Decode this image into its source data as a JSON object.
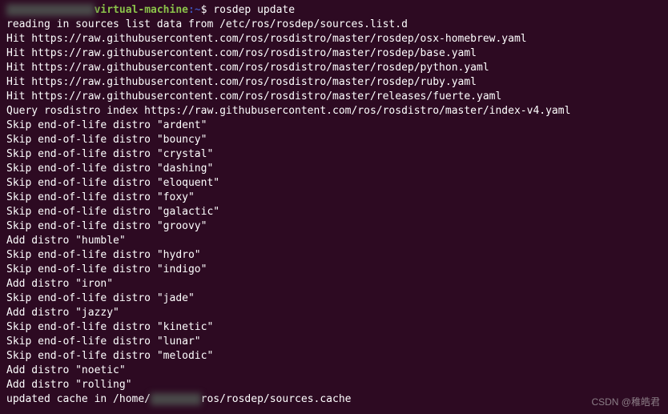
{
  "prompt": {
    "user_blur": "xxxxxxxxxxxxxx",
    "host_suffix": "virtual-machine",
    "separator": ":",
    "path": "~",
    "symbol": "$",
    "command": "rosdep update"
  },
  "output": [
    "reading in sources list data from /etc/ros/rosdep/sources.list.d",
    "Hit https://raw.githubusercontent.com/ros/rosdistro/master/rosdep/osx-homebrew.yaml",
    "Hit https://raw.githubusercontent.com/ros/rosdistro/master/rosdep/base.yaml",
    "Hit https://raw.githubusercontent.com/ros/rosdistro/master/rosdep/python.yaml",
    "Hit https://raw.githubusercontent.com/ros/rosdistro/master/rosdep/ruby.yaml",
    "Hit https://raw.githubusercontent.com/ros/rosdistro/master/releases/fuerte.yaml",
    "Query rosdistro index https://raw.githubusercontent.com/ros/rosdistro/master/index-v4.yaml",
    "Skip end-of-life distro \"ardent\"",
    "Skip end-of-life distro \"bouncy\"",
    "Skip end-of-life distro \"crystal\"",
    "Skip end-of-life distro \"dashing\"",
    "Skip end-of-life distro \"eloquent\"",
    "Skip end-of-life distro \"foxy\"",
    "Skip end-of-life distro \"galactic\"",
    "Skip end-of-life distro \"groovy\"",
    "Add distro \"humble\"",
    "Skip end-of-life distro \"hydro\"",
    "Skip end-of-life distro \"indigo\"",
    "Add distro \"iron\"",
    "Skip end-of-life distro \"jade\"",
    "Add distro \"jazzy\"",
    "Skip end-of-life distro \"kinetic\"",
    "Skip end-of-life distro \"lunar\"",
    "Skip end-of-life distro \"melodic\"",
    "Add distro \"noetic\"",
    "Add distro \"rolling\""
  ],
  "last_line": {
    "prefix": "updated cache in /home/",
    "blur": "xxxxxxxx",
    "suffix": "ros/rosdep/sources.cache"
  },
  "watermark": "CSDN @稚皓君"
}
